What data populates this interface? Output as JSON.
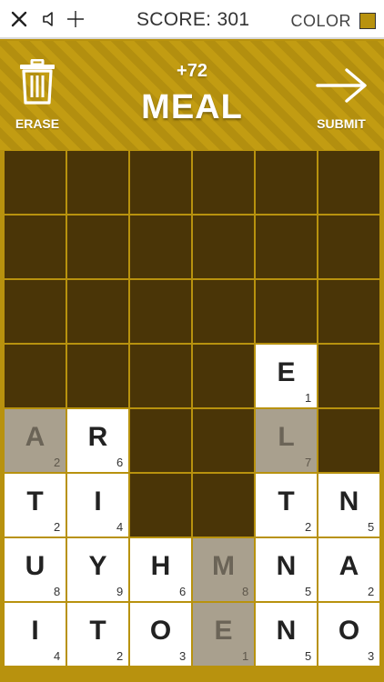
{
  "topbar": {
    "close_icon": "close-icon",
    "sound_icon": "speaker-icon",
    "add_icon": "plus-icon",
    "score_text": "SCORE: 301",
    "color_label": "COLOR",
    "color_value": "#b8920e"
  },
  "header": {
    "erase_label": "ERASE",
    "submit_label": "SUBMIT",
    "points": "+72",
    "word": "MEAL"
  },
  "board": {
    "columns": 6,
    "rows": 8,
    "cells": [
      [
        null,
        null,
        null,
        null,
        null,
        null
      ],
      [
        null,
        null,
        null,
        null,
        null,
        null
      ],
      [
        null,
        null,
        null,
        null,
        null,
        null
      ],
      [
        null,
        null,
        null,
        null,
        {
          "letter": "E",
          "points": "1",
          "state": "normal"
        },
        null
      ],
      [
        {
          "letter": "A",
          "points": "2",
          "state": "selected"
        },
        {
          "letter": "R",
          "points": "6",
          "state": "normal"
        },
        null,
        null,
        {
          "letter": "L",
          "points": "7",
          "state": "selected"
        },
        null
      ],
      [
        {
          "letter": "T",
          "points": "2",
          "state": "normal"
        },
        {
          "letter": "I",
          "points": "4",
          "state": "normal"
        },
        null,
        null,
        {
          "letter": "T",
          "points": "2",
          "state": "normal"
        },
        {
          "letter": "N",
          "points": "5",
          "state": "normal"
        }
      ],
      [
        {
          "letter": "U",
          "points": "8",
          "state": "normal"
        },
        {
          "letter": "Y",
          "points": "9",
          "state": "normal"
        },
        {
          "letter": "H",
          "points": "6",
          "state": "normal"
        },
        {
          "letter": "M",
          "points": "8",
          "state": "selected"
        },
        {
          "letter": "N",
          "points": "5",
          "state": "normal"
        },
        {
          "letter": "A",
          "points": "2",
          "state": "normal"
        }
      ],
      [
        {
          "letter": "I",
          "points": "4",
          "state": "normal"
        },
        {
          "letter": "T",
          "points": "2",
          "state": "normal"
        },
        {
          "letter": "O",
          "points": "3",
          "state": "normal"
        },
        {
          "letter": "E",
          "points": "1",
          "state": "selected"
        },
        {
          "letter": "N",
          "points": "5",
          "state": "normal"
        },
        {
          "letter": "O",
          "points": "3",
          "state": "normal"
        }
      ]
    ]
  }
}
